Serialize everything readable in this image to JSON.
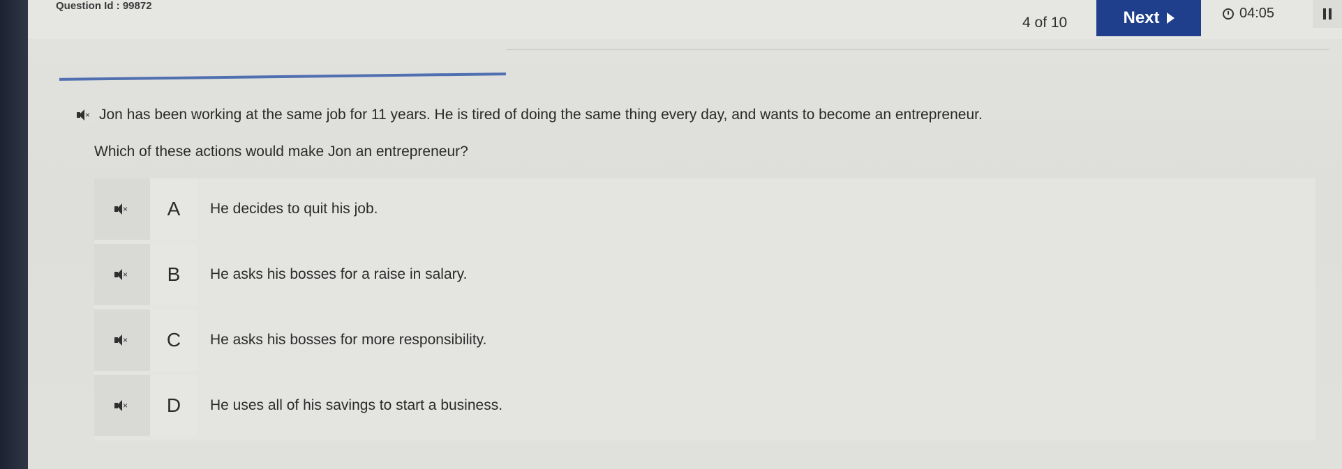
{
  "header": {
    "question_id": "Question Id : 99872",
    "progress": "4 of 10",
    "next_label": "Next",
    "timer": "04:05"
  },
  "question": {
    "prompt": "Jon has been working at the same job for 11 years. He is tired of doing the same thing every day, and wants to become an entrepreneur.",
    "text": "Which of these actions would make Jon an entrepreneur?"
  },
  "options": [
    {
      "letter": "A",
      "text": "He decides to quit his job."
    },
    {
      "letter": "B",
      "text": "He asks his bosses for a raise in salary."
    },
    {
      "letter": "C",
      "text": "He asks his bosses for more responsibility."
    },
    {
      "letter": "D",
      "text": "He uses all of his savings to start a business."
    }
  ],
  "colors": {
    "accent": "#1f3f8c",
    "divider": "#4f6fb0"
  },
  "icons": {
    "audio": "speaker-mute-icon",
    "timer": "clock-icon",
    "pause": "pause-icon",
    "next": "play-arrow-icon"
  }
}
